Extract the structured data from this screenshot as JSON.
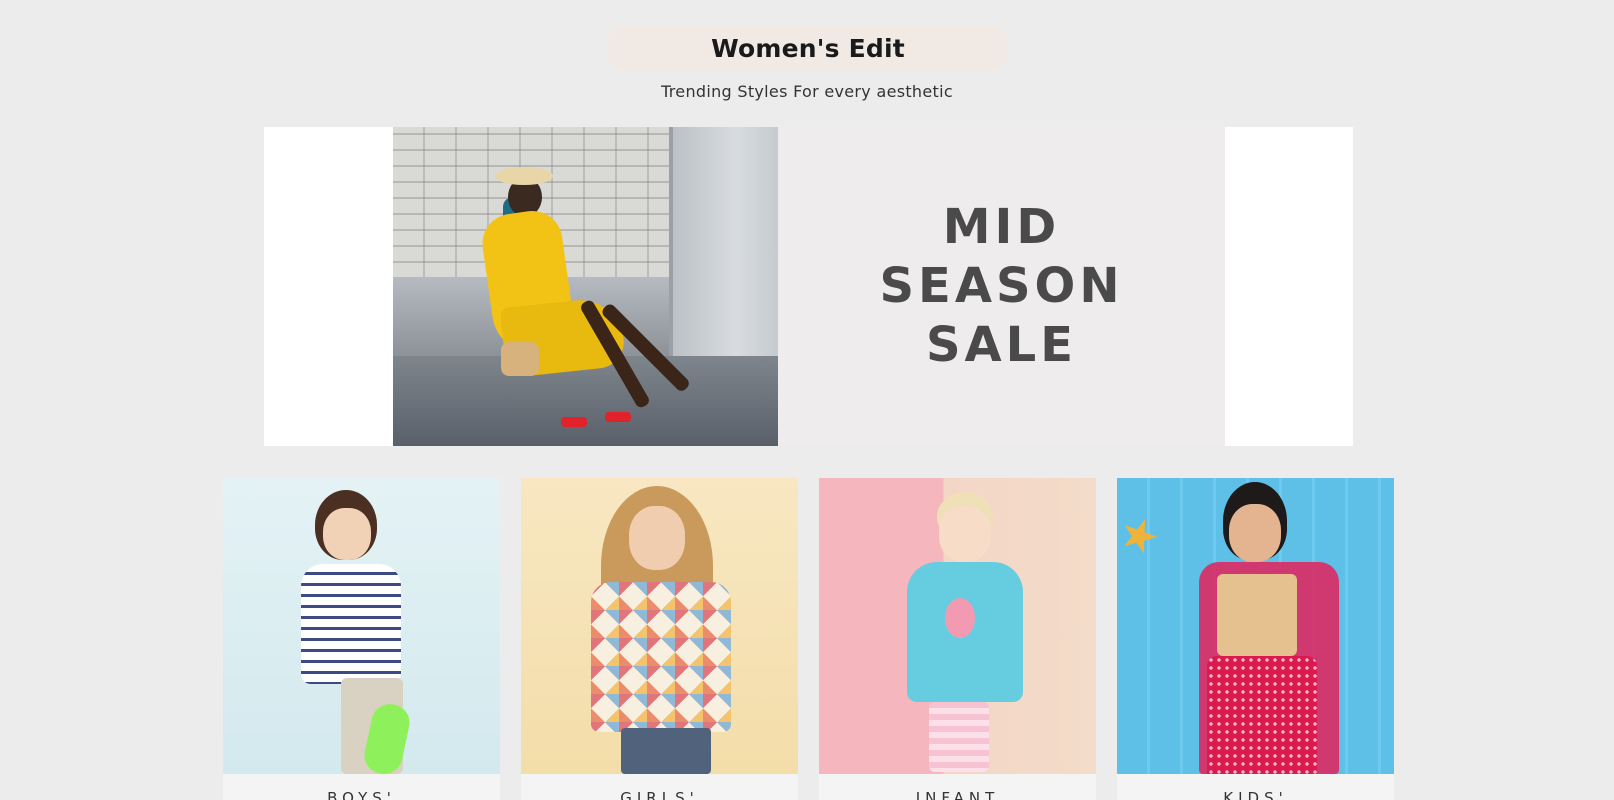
{
  "section": {
    "title": "Women's Edit",
    "subtitle": "Trending Styles For every aesthetic"
  },
  "banner": {
    "sale_lines": [
      "MID",
      "SEASON",
      "SALE"
    ],
    "sale_text_color": "#4a4a4a",
    "sale_bg_color": "#efeced"
  },
  "categories": [
    {
      "label": "BOYS'",
      "image": "boy-with-skateboard"
    },
    {
      "label": "GIRLS'",
      "image": "girl-in-patchwork-top"
    },
    {
      "label": "INFANT",
      "image": "toddler-in-flamingo-dress"
    },
    {
      "label": "KIDS'",
      "image": "girl-in-ethnic-lehenga"
    }
  ],
  "colors": {
    "page_bg": "#ececec",
    "title_pill_bg": "#f1e9e3"
  }
}
